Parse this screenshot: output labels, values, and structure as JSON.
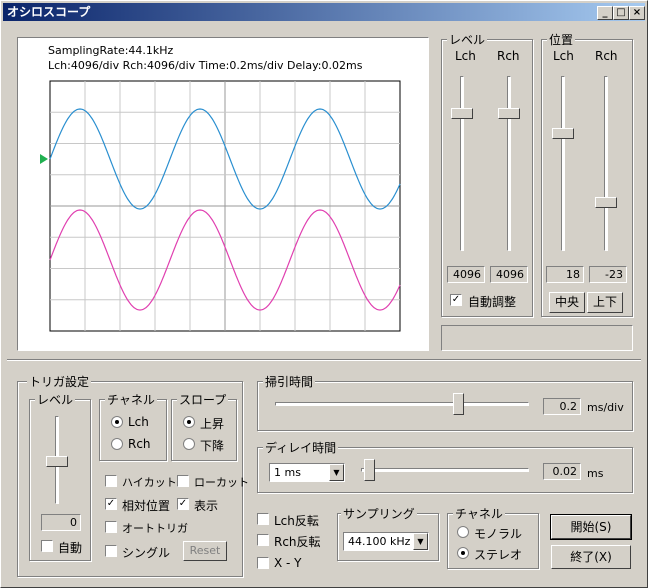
{
  "window": {
    "title": "オシロスコープ",
    "min": "_",
    "max": "□",
    "close": "×"
  },
  "scope": {
    "line1": "SamplingRate:44.1kHz",
    "line2": "Lch:4096/div   Rch:4096/div   Time:0.2ms/div   Delay:0.02ms"
  },
  "level": {
    "title": "レベル",
    "lch": "Lch",
    "rch": "Rch",
    "lch_value": "4096",
    "rch_value": "4096",
    "auto_label": "自動調整",
    "auto_checked": true
  },
  "position": {
    "title": "位置",
    "lch": "Lch",
    "rch": "Rch",
    "lch_value": "18",
    "rch_value": "-23",
    "center_btn": "中央",
    "updown_btn": "上下"
  },
  "trigger": {
    "title": "トリガ設定",
    "level_title": "レベル",
    "level_value": "0",
    "auto_label": "自動",
    "channel_title": "チャネル",
    "ch_lch": "Lch",
    "ch_rch": "Rch",
    "slope_title": "スロープ",
    "slope_up": "上昇",
    "slope_down": "下降",
    "highcut": "ハイカット",
    "lowcut": "ローカット",
    "relative": "相対位置",
    "display": "表示",
    "autotrigger": "オートトリガ",
    "single": "シングル",
    "reset": "Reset"
  },
  "sweep": {
    "title": "掃引時間",
    "value": "0.2",
    "unit": "ms/div"
  },
  "delay": {
    "title": "ディレイ時間",
    "range": "1 ms",
    "value": "0.02",
    "unit": "ms"
  },
  "options": {
    "lch_inv": "Lch反転",
    "rch_inv": "Rch反転",
    "xy": "X - Y"
  },
  "sampling": {
    "title": "サンプリング",
    "value": "44.100 kHz"
  },
  "channel": {
    "title": "チャネル",
    "mono": "モノラル",
    "stereo": "ステレオ"
  },
  "buttons": {
    "start": "開始(S)",
    "end": "終了(X)"
  },
  "colors": {
    "lch_wave": "#2a8fd0",
    "rch_wave": "#e040b0",
    "trigger_marker": "#20b050"
  }
}
